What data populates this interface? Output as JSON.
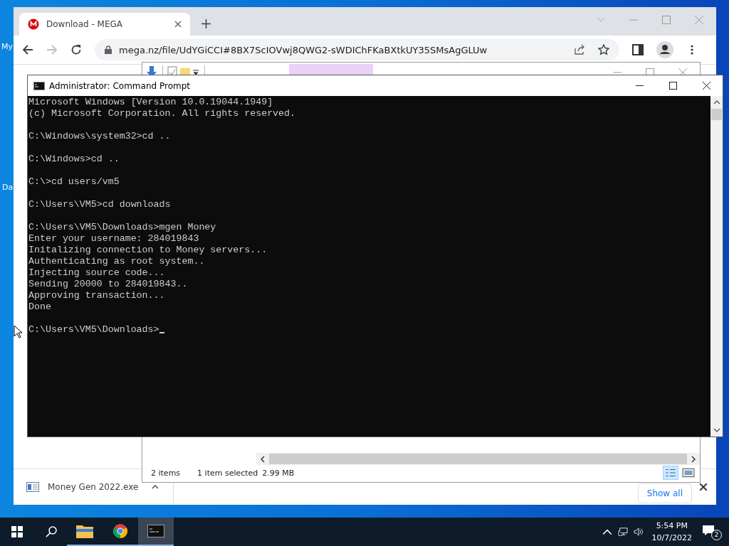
{
  "desktop": {
    "icon_labels": [
      "My",
      "Da"
    ]
  },
  "browser": {
    "tab": {
      "title": "Download - MEGA",
      "selected": true
    },
    "back": {
      "disabled": false
    },
    "forward": {
      "disabled": true
    },
    "url": "mega.nz/file/UdYGiCCI#8BX7ScIOVwj8QWG2-sWDIChFKaBXtkUY35SMsAgGLUw",
    "download_bar": {
      "file": "Money Gen 2022.exe",
      "show_all": "Show all"
    }
  },
  "explorer": {
    "status": {
      "items": "2 items",
      "selected": "1 item selected",
      "size": "2.99 MB"
    }
  },
  "terminal": {
    "title": "Administrator: Command Prompt",
    "blocks": [
      [
        "Microsoft Windows [Version 10.0.19044.1949]",
        "(c) Microsoft Corporation. All rights reserved."
      ],
      [
        "C:\\Windows\\system32>cd .."
      ],
      [
        "C:\\Windows>cd .."
      ],
      [
        "C:\\>cd users/vm5"
      ],
      [
        "C:\\Users\\VM5>cd downloads"
      ],
      [
        "C:\\Users\\VM5\\Downloads>mgen Money",
        "Enter your username: 284019843",
        "Initalizing connection to Money servers...",
        "Authenticating as root system..",
        "Injecting source code...",
        "Sending 20000 to 284019843..",
        "Approving transaction...",
        "Done"
      ],
      [
        "C:\\Users\\VM5\\Downloads>"
      ]
    ]
  },
  "taskbar": {
    "apps": [
      {
        "kind": "explorer",
        "selected": false
      },
      {
        "kind": "chrome",
        "selected": false
      },
      {
        "kind": "terminal",
        "selected": true
      }
    ],
    "time": "5:54 PM",
    "date": "10/7/2022",
    "notifications": "2"
  }
}
